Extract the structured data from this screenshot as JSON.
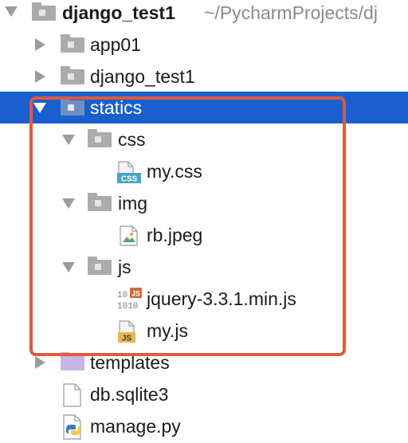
{
  "project": {
    "name": "django_test1",
    "path": "~/PycharmProjects/dj"
  },
  "items": [
    {
      "label": "app01"
    },
    {
      "label": "django_test1"
    },
    {
      "label": "statics"
    },
    {
      "label": "css"
    },
    {
      "label": "my.css",
      "badge": "CSS"
    },
    {
      "label": "img"
    },
    {
      "label": "rb.jpeg"
    },
    {
      "label": "js"
    },
    {
      "label": "jquery-3.3.1.min.js",
      "badge": "JS",
      "binary": "1010"
    },
    {
      "label": "my.js",
      "badge": "JS"
    },
    {
      "label": "templates"
    },
    {
      "label": "db.sqlite3"
    },
    {
      "label": "manage.py"
    }
  ],
  "colors": {
    "selection": "#1a5fce",
    "highlight_border": "#e05a3c"
  },
  "icons": [
    "chevron-down-icon",
    "chevron-right-icon",
    "folder-icon",
    "css-file-icon",
    "image-file-icon",
    "js-file-icon",
    "minified-js-file-icon",
    "file-icon",
    "python-file-icon"
  ]
}
